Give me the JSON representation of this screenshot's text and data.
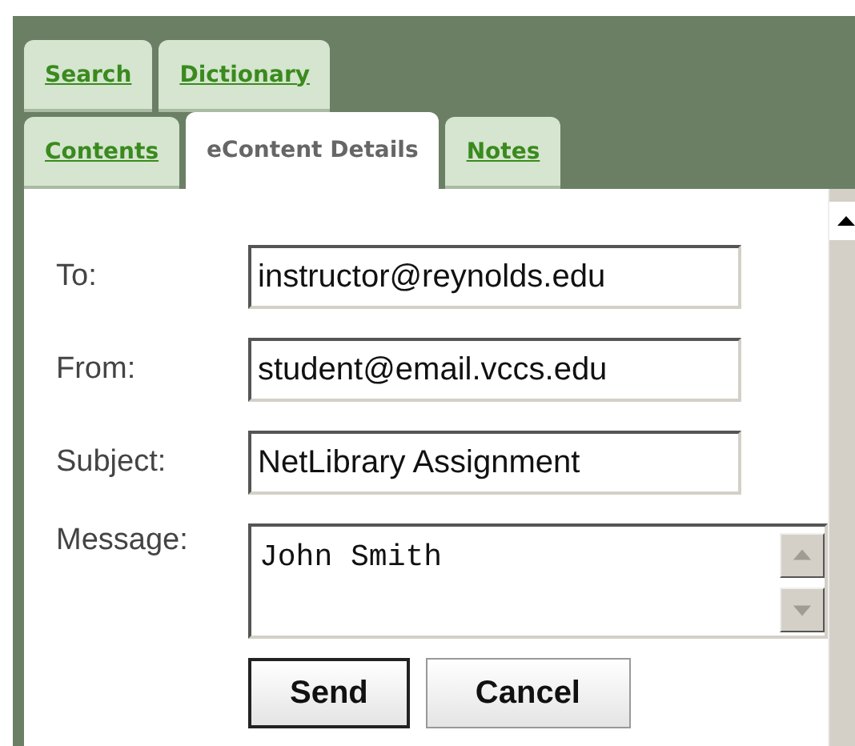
{
  "tab_rows": [
    {
      "tabs": [
        {
          "label": "Search",
          "selected": false
        },
        {
          "label": "Dictionary",
          "selected": false
        }
      ]
    },
    {
      "tabs": [
        {
          "label": "Contents",
          "selected": false
        },
        {
          "label": "eContent Details",
          "selected": true
        },
        {
          "label": "Notes",
          "selected": false
        }
      ]
    }
  ],
  "form": {
    "fields": [
      {
        "kind": "text",
        "label": "To:",
        "value": "instructor@reynolds.edu"
      },
      {
        "kind": "text",
        "label": "From:",
        "value": "student@email.vccs.edu"
      },
      {
        "kind": "text",
        "label": "Subject:",
        "value": "NetLibrary Assignment"
      },
      {
        "kind": "textarea",
        "label": "Message:",
        "value": "John Smith"
      }
    ],
    "buttons": [
      {
        "label": "Send",
        "default": true
      },
      {
        "label": "Cancel",
        "default": false
      }
    ]
  }
}
